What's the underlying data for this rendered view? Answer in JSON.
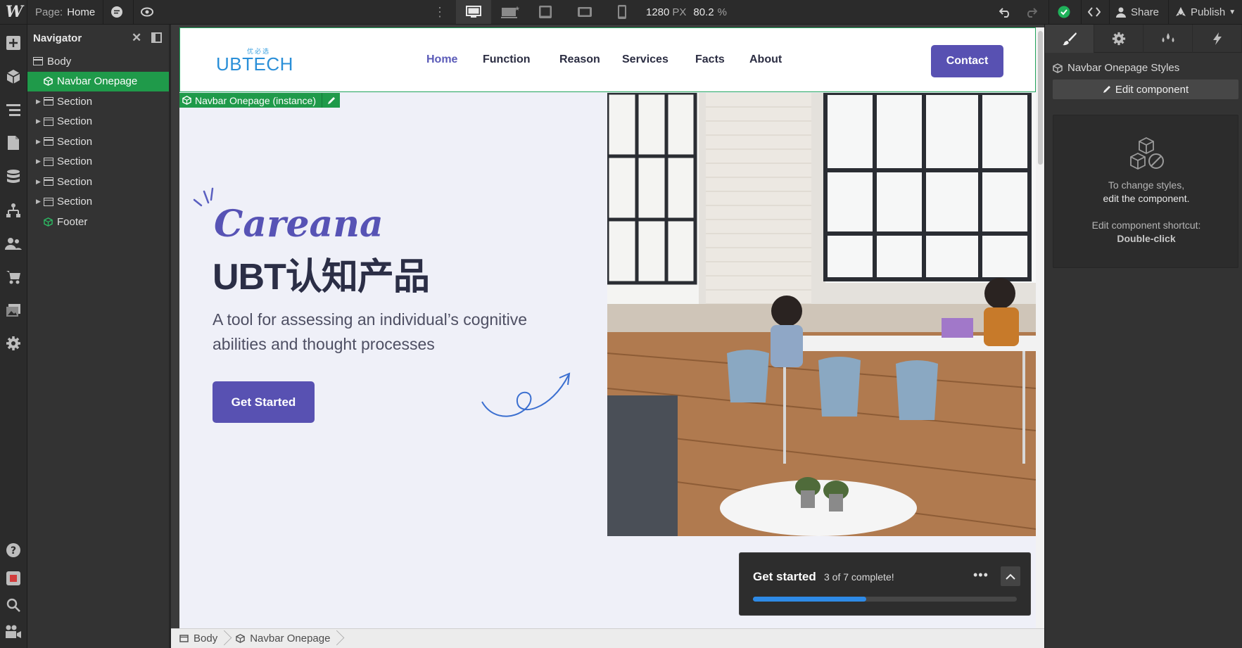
{
  "topbar": {
    "page_label": "Page:",
    "page_name": "Home",
    "width_value": "1280",
    "width_unit": "PX",
    "zoom": "80.2",
    "zoom_unit": "%",
    "share_label": "Share",
    "publish_label": "Publish"
  },
  "navigator": {
    "title": "Navigator",
    "items": [
      {
        "label": "Body"
      },
      {
        "label": "Navbar Onepage"
      },
      {
        "label": "Section"
      },
      {
        "label": "Section"
      },
      {
        "label": "Section"
      },
      {
        "label": "Section"
      },
      {
        "label": "Section"
      },
      {
        "label": "Section"
      },
      {
        "label": "Footer"
      }
    ]
  },
  "site": {
    "brand_main": "UBTECH",
    "brand_sub": "优必选",
    "nav_links": [
      "Home",
      "Function",
      "Reason",
      "Services",
      "Facts",
      "About"
    ],
    "contact_label": "Contact",
    "instance_tag": "Navbar Onepage (instance)",
    "hero_script": "Careana",
    "hero_title": "UBT认知产品",
    "hero_sub": "A tool for assessing an individual’s cognitive abilities and thought processes",
    "cta_label": "Get Started"
  },
  "get_started": {
    "title": "Get started",
    "progress_text": "3 of 7 complete!",
    "progress_fraction": 0.4286
  },
  "breadcrumb": [
    "Body",
    "Navbar Onepage"
  ],
  "right_panel": {
    "component_styles": "Navbar Onepage Styles",
    "edit_label": "Edit component",
    "info_line1": "To change styles,",
    "info_line2": "edit the component.",
    "shortcut_line": "Edit component shortcut:",
    "shortcut_value": "Double-click"
  },
  "colors": {
    "accent_green": "#1f9a4a",
    "brand_purple": "#5851b2",
    "progress_blue": "#2e8ae6"
  }
}
